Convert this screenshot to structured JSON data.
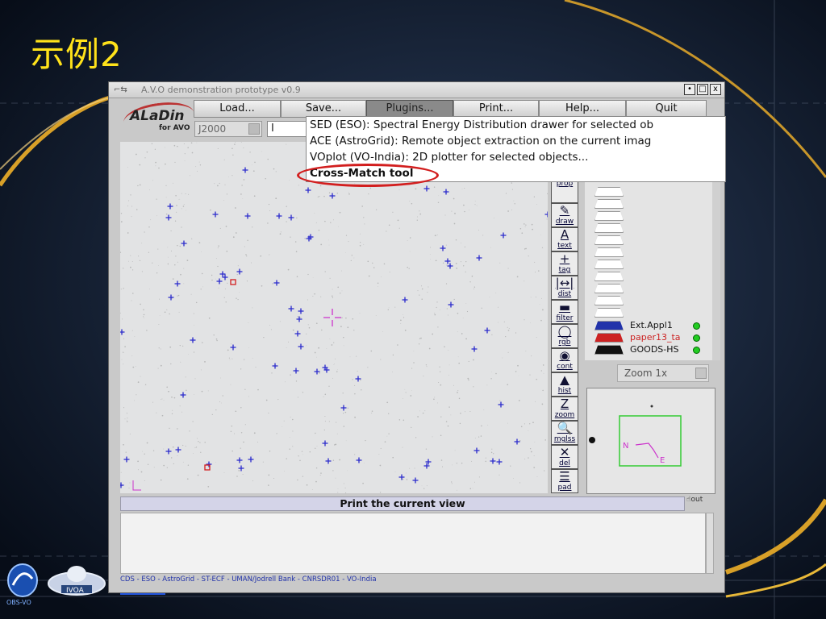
{
  "slide": {
    "title": "示例2"
  },
  "window": {
    "title": "A.V.O demonstration prototype v0.9",
    "controls": [
      "•",
      "□",
      "x"
    ]
  },
  "app": {
    "logo_main": "ALaDin",
    "logo_sub": "for AVO"
  },
  "menu": [
    {
      "label": "Load...",
      "active": false
    },
    {
      "label": "Save...",
      "active": false
    },
    {
      "label": "Plugins...",
      "active": true
    },
    {
      "label": "Print...",
      "active": false
    },
    {
      "label": "Help...",
      "active": false
    },
    {
      "label": "Quit",
      "active": false
    }
  ],
  "coords": {
    "frame": "J2000",
    "input_value": "I"
  },
  "plugins_menu": [
    "SED (ESO): Spectral Energy Distribution drawer for selected ob",
    "ACE (AstroGrid): Remote object extraction on the current imag",
    "VOplot (VO-India): 2D plotter for selected objects...",
    "Cross-Match tool"
  ],
  "tools": [
    {
      "glyph": "",
      "label": "prop"
    },
    {
      "glyph": "✎",
      "label": "draw"
    },
    {
      "glyph": "A",
      "label": "text"
    },
    {
      "glyph": "+",
      "label": "tag"
    },
    {
      "glyph": "|↔|",
      "label": "dist"
    },
    {
      "glyph": "▬",
      "label": "filter"
    },
    {
      "glyph": "◯",
      "label": "rgb"
    },
    {
      "glyph": "◉",
      "label": "cont"
    },
    {
      "glyph": "▲",
      "label": "hist"
    },
    {
      "glyph": "Z",
      "label": "zoom"
    },
    {
      "glyph": "🔍",
      "label": "mglss"
    },
    {
      "glyph": "✕",
      "label": "del"
    },
    {
      "glyph": "☰",
      "label": "pad"
    }
  ],
  "layers": [
    {
      "label": "Ext.Appl1",
      "color": "#2233aa"
    },
    {
      "label": "paper13_ta",
      "color": "#cc2222"
    },
    {
      "label": "GOODS-HS",
      "color": "#111111"
    }
  ],
  "zoom": {
    "value": "Zoom 1x"
  },
  "navigator": {
    "north_label": "N",
    "east_label": "E"
  },
  "status": {
    "text": "Print the current view"
  },
  "out_icon": "out",
  "footer": {
    "text": "CDS - ESO - AstroGrid - ST-ECF - UMAN/Jodrell Bank - CNRSDR01 - VO-India"
  },
  "logos": {
    "left": "OBS-VO",
    "right": "IVOA"
  },
  "colors": {
    "title": "#ffe21a",
    "star_marker": "#2a2acc",
    "selection": "#d21e1e",
    "highlight": "#cc33cc"
  }
}
